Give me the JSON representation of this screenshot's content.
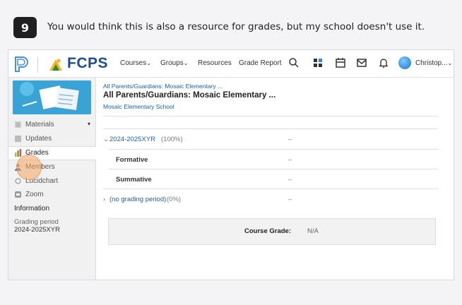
{
  "step": {
    "number": "9",
    "text": "You would think this is also a resource for grades, but my school doesn't use it."
  },
  "topnav": {
    "brand": "FCPS",
    "items": [
      {
        "label": "Courses",
        "caret": "⌄"
      },
      {
        "label": "Groups",
        "caret": "⌄"
      },
      {
        "label": "Resources",
        "caret": ""
      },
      {
        "label": "Grade Report",
        "caret": ""
      }
    ],
    "icons": [
      "search-icon",
      "apps-icon",
      "calendar-icon",
      "mail-icon",
      "bell-icon"
    ],
    "user_name": "Christop...",
    "user_caret": "⌄"
  },
  "sidebar": {
    "items": [
      {
        "label": "Materials",
        "icon": "materials-icon",
        "caret": "▾"
      },
      {
        "label": "Updates",
        "icon": "updates-icon"
      },
      {
        "label": "Grades",
        "icon": "grades-icon",
        "active": true
      },
      {
        "label": "Members",
        "icon": "members-icon"
      },
      {
        "label": "Lucidchart",
        "icon": "lucidchart-icon"
      },
      {
        "label": "Zoom",
        "icon": "zoom-icon"
      }
    ],
    "info_heading": "Information",
    "grading_period_label": "Grading period",
    "grading_period_value": "2024-2025XYR"
  },
  "main": {
    "breadcrumb": "All Parents/Guardians: Mosaic Elementary ...",
    "title": "All Parents/Guardians: Mosaic Elementary ...",
    "school": "Mosaic Elementary School",
    "rows": [
      {
        "chevron": "⌄",
        "name": "2024-2025XYR",
        "pct": "(100%)",
        "value": "–"
      },
      {
        "name": "Formative",
        "value": "–"
      },
      {
        "name": "Summative",
        "value": "–"
      },
      {
        "chevron": "›",
        "name": "(no grading period)",
        "pct": "(0%)",
        "value": "–"
      }
    ],
    "course_grade_label": "Course Grade:",
    "course_grade_value": "N/A"
  },
  "colors": {
    "accent": "#1f5fa8",
    "brand": "#1e4e8c",
    "highlight": "#f4a460"
  }
}
